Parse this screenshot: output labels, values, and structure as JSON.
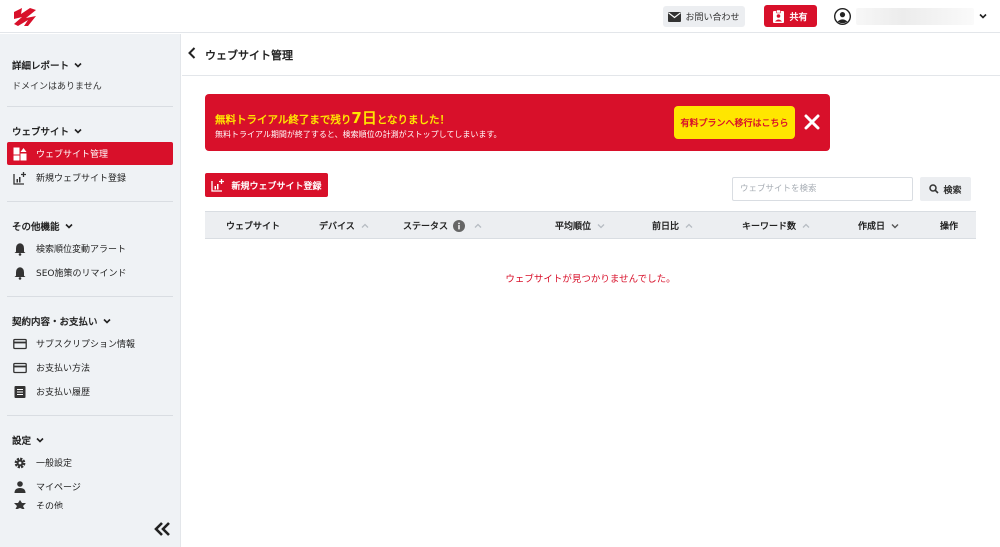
{
  "header": {
    "contact_label": "お問い合わせ",
    "share_label": "共有",
    "icons": [
      "logo-icon",
      "mail-icon",
      "share-badge-icon",
      "user-avatar-icon",
      "chevron-down-icon"
    ]
  },
  "sidebar": {
    "sections": [
      {
        "title": "詳細レポート",
        "sub": "ドメインはありません"
      },
      {
        "title": "ウェブサイト",
        "items": [
          {
            "label": "ウェブサイト管理",
            "icon": "dashboard-icon",
            "active": true
          },
          {
            "label": "新規ウェブサイト登録",
            "icon": "add-chart-icon"
          }
        ]
      },
      {
        "title": "その他機能",
        "items": [
          {
            "label": "検索順位変動アラート",
            "icon": "bell-icon"
          },
          {
            "label": "SEO施策のリマインド",
            "icon": "bell-icon"
          }
        ]
      },
      {
        "title": "契約内容・お支払い",
        "items": [
          {
            "label": "サブスクリプション情報",
            "icon": "credit-card-icon"
          },
          {
            "label": "お支払い方法",
            "icon": "credit-card-icon"
          },
          {
            "label": "お支払い履歴",
            "icon": "receipt-icon"
          }
        ]
      },
      {
        "title": "設定",
        "items": [
          {
            "label": "一般設定",
            "icon": "gear-icon"
          },
          {
            "label": "マイページ",
            "icon": "person-icon"
          },
          {
            "label": "その他",
            "icon": "more-icon"
          }
        ]
      }
    ]
  },
  "page": {
    "title": "ウェブサイト管理"
  },
  "banner": {
    "headline_pre": "無料トライアル終了まで残り",
    "headline_days": "7日",
    "headline_post": "となりました！",
    "description": "無料トライアル期間が終了すると、検索順位の計測がストップしてしまいます。",
    "upgrade_label": "有料プランへ移行はこちら"
  },
  "toolbar": {
    "add_label": "新規ウェブサイト登録",
    "search_placeholder": "ウェブサイトを検索",
    "search_value": "",
    "search_label": "検索"
  },
  "table": {
    "columns": [
      {
        "label": "ウェブサイト",
        "sort": "none"
      },
      {
        "label": "デバイス",
        "sort": "up"
      },
      {
        "label": "ステータス",
        "sort": "up",
        "info": true
      },
      {
        "label": "平均順位",
        "sort": "down"
      },
      {
        "label": "前日比",
        "sort": "up"
      },
      {
        "label": "キーワード数",
        "sort": "up"
      },
      {
        "label": "作成日",
        "sort": "down"
      },
      {
        "label": "操作",
        "sort": "none"
      }
    ],
    "rows": [],
    "empty_message": "ウェブサイトが見つかりませんでした。"
  },
  "colors": {
    "brand_red": "#d8102a",
    "banner_yellow": "#ffe600",
    "sidebar_bg": "#eff2f5",
    "table_header_bg": "#eceef1"
  }
}
